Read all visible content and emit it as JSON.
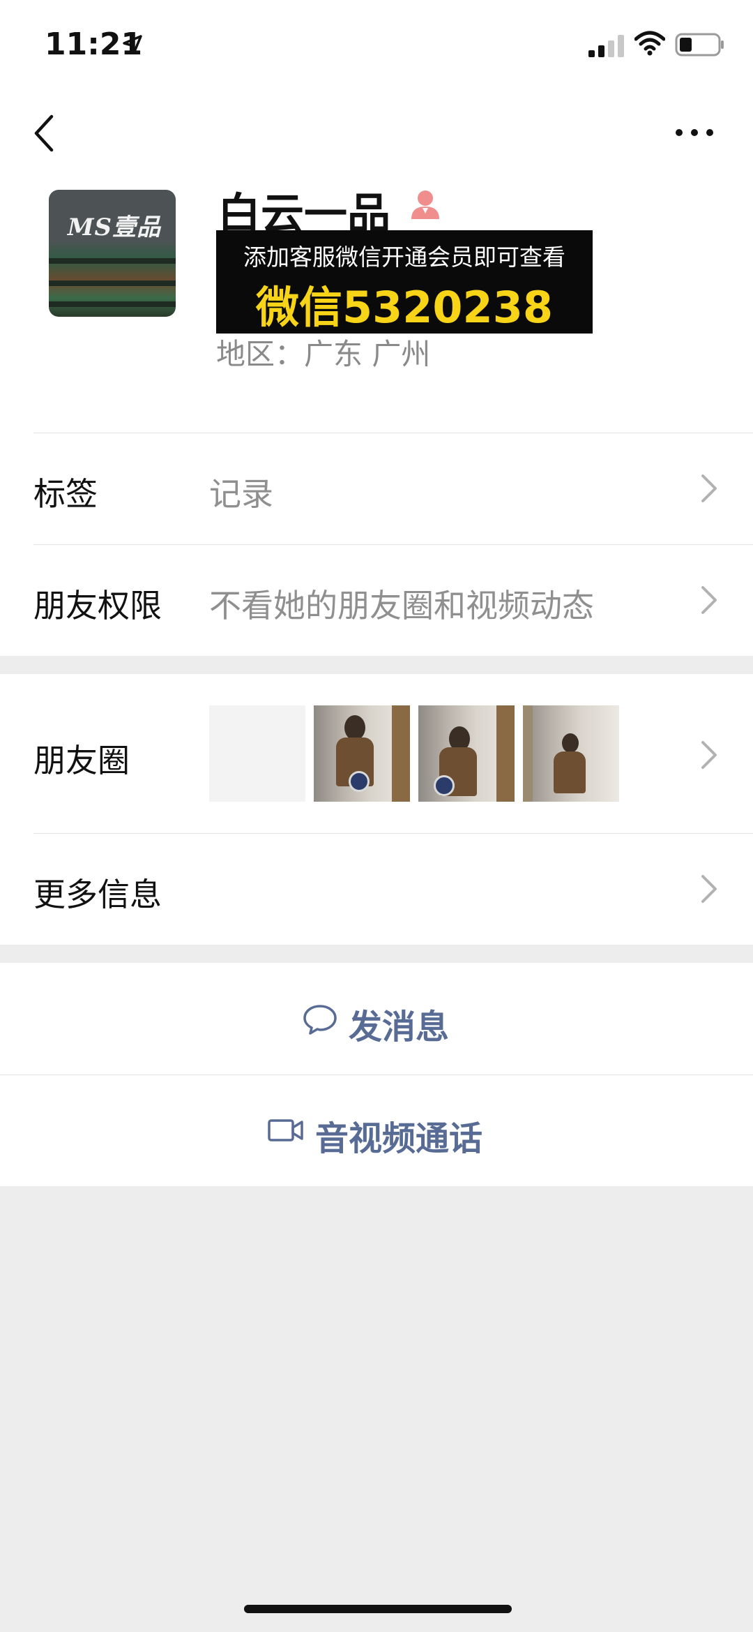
{
  "status_bar": {
    "time": "11:21",
    "icons": [
      "location-arrow-icon",
      "cellular-signal-icon",
      "wifi-icon",
      "battery-icon"
    ]
  },
  "nav": {
    "back_icon": "chevron-left-icon",
    "more_icon": "more-dots-icon"
  },
  "profile": {
    "avatar_text": "MS壹品",
    "name": "白云一品",
    "gender_icon": "female-person-icon",
    "promo_line1": "添加客服微信开通会员即可查看",
    "promo_line2": "微信5320238",
    "region": "地区：广东 广州"
  },
  "rows": {
    "tags": {
      "label": "标签",
      "value": "记录"
    },
    "permissions": {
      "label": "朋友权限",
      "value": "不看她的朋友圈和视频动态"
    },
    "moments": {
      "label": "朋友圈"
    },
    "more_info": {
      "label": "更多信息"
    }
  },
  "actions": {
    "message": {
      "label": "发消息",
      "icon": "chat-bubble-icon"
    },
    "call": {
      "label": "音视频通话",
      "icon": "video-camera-icon"
    }
  },
  "colors": {
    "link": "#576b95",
    "background": "#ededed",
    "promo_bg": "#0a0a0a",
    "promo_highlight": "#f7d417",
    "gender_icon": "#f08d8d"
  }
}
